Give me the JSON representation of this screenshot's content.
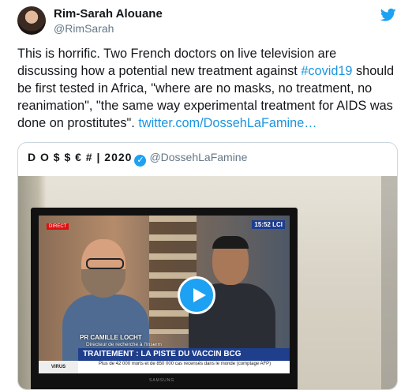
{
  "tweet": {
    "author_name": "Rim-Sarah Alouane",
    "author_handle": "@RimSarah",
    "text_before_hashtag": "This is horrific. Two French doctors on live television are discussing how a potential new treatment against ",
    "hashtag": "#covid19",
    "text_after_hashtag": " should be first tested in Africa, \"where are no masks, no treatment, no reanimation\", \"the same way experimental treatment for AIDS was done on prostitutes\". ",
    "link": "twitter.com/DossehLaFamine…"
  },
  "quoted": {
    "name": "D O $ $ € # | 2020",
    "handle": "@DossehLaFamine",
    "video": {
      "live_tag": "DIRECT",
      "channel": "15:52 LCI",
      "caption_name": "PR CAMILLE LOCHT",
      "caption_title": "Directeur de recherche à l'Inserm",
      "headline": "TRAITEMENT : LA PISTE DU VACCIN BCG",
      "section": "VIRUS",
      "ticker": "Plus de 42 000 morts et de 850 000 cas recensés dans le monde (comptage AFP)",
      "tv_brand": "SAMSUNG"
    }
  },
  "icons": {
    "bird": "twitter-bird-icon",
    "verified": "verified-badge-icon",
    "play": "play-icon"
  },
  "colors": {
    "link": "#1b95e0",
    "accent": "#1da1f2",
    "secondary_text": "#657786",
    "border": "#ccd6dd"
  }
}
